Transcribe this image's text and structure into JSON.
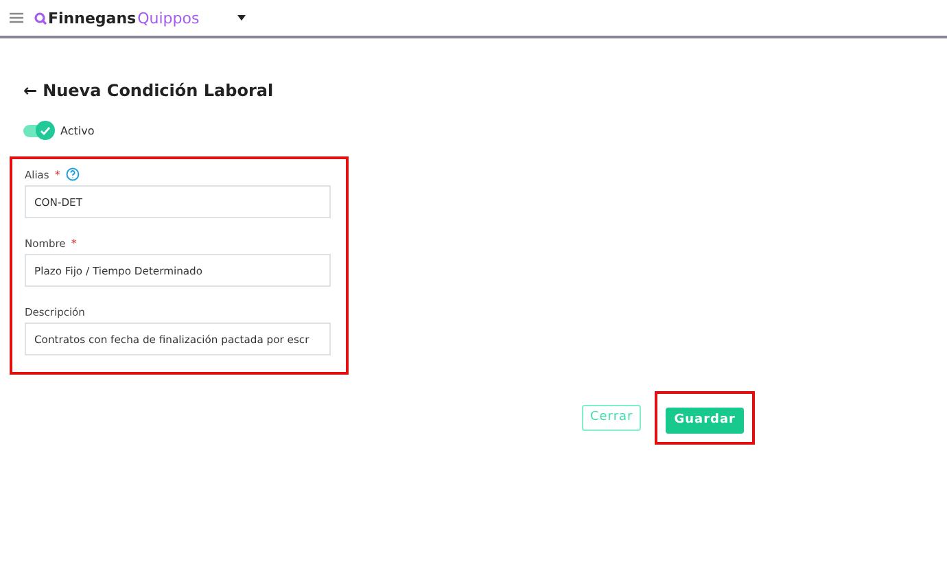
{
  "header": {
    "brand_first": "Finnegans",
    "brand_second": "Quippos"
  },
  "page": {
    "back": "←",
    "title": "Nueva Condición Laboral"
  },
  "active_toggle": {
    "label": "Activo",
    "on": true
  },
  "fields": [
    {
      "label": "Alias",
      "required_mark": "*",
      "help": true,
      "value": "CON-DET"
    },
    {
      "label": "Nombre",
      "required_mark": "*",
      "help": false,
      "value": "Plazo Fijo / Tiempo Determinado"
    },
    {
      "label": "Descripción",
      "help": false,
      "value": "Contratos con fecha de finalización pactada por escr"
    }
  ],
  "buttons": [
    {
      "label": "Cerrar",
      "kind": "outline"
    },
    {
      "label": "Guardar",
      "kind": "primary"
    }
  ]
}
